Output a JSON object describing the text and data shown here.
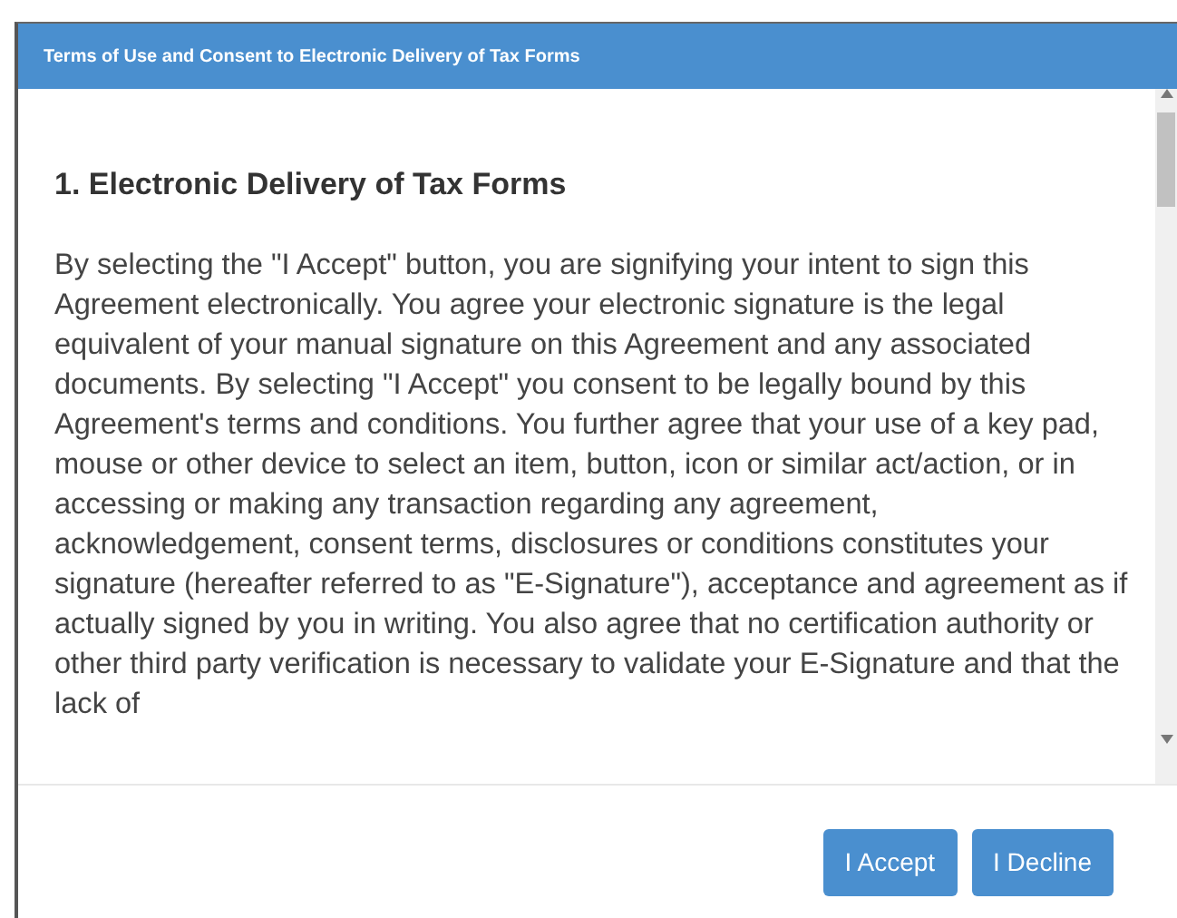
{
  "window": {
    "title": "Terms of Use and Consent to Electronic Delivery of Tax Forms"
  },
  "section": {
    "heading": "1. Electronic Delivery of Tax Forms",
    "text": "By selecting the \"I Accept\" button, you are signifying your intent to sign this Agreement electronically. You agree your electronic signature is the legal equivalent of your manual signature on this Agreement and any associated documents. By selecting \"I Accept\" you consent to be legally bound by this Agreement's terms and conditions. You further agree that your use of a key pad, mouse or other device to select an item, button, icon or similar act/action, or in accessing or making any transaction regarding any agreement, acknowledgement, consent terms, disclosures or conditions constitutes your signature (hereafter referred to as \"E-Signature\"), acceptance and agreement as if actually signed by you in writing. You also agree that no certification authority or other third party verification is necessary to validate your E-Signature and that the lack of"
  },
  "buttons": [
    "I Accept",
    "I Decline"
  ]
}
